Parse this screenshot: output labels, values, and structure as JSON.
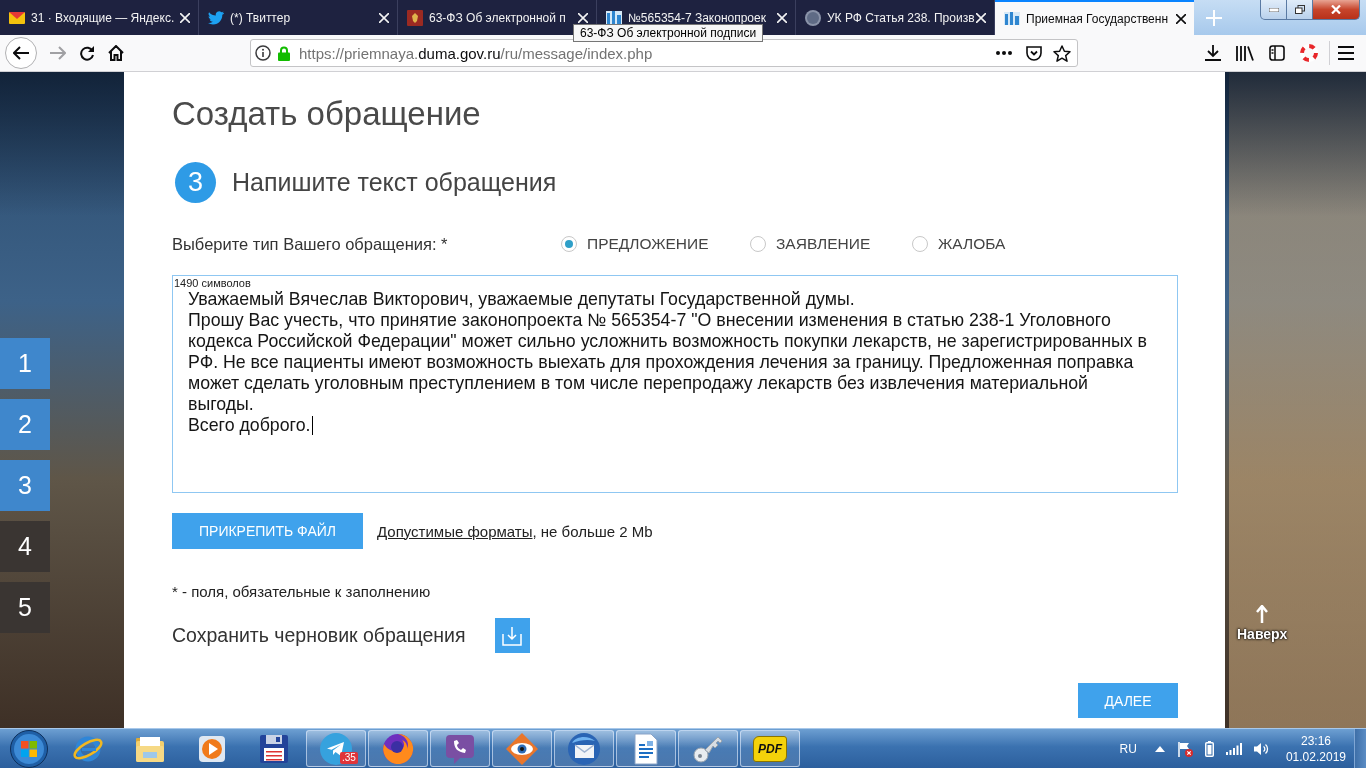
{
  "browser": {
    "tabs": [
      {
        "kind": "mail",
        "title": "31 · Входящие — Яндекс.",
        "selected": false
      },
      {
        "kind": "bird",
        "title": "(*) Твиттер",
        "selected": false
      },
      {
        "kind": "emblem",
        "title": "63-ФЗ Об электронной п",
        "selected": false
      },
      {
        "kind": "bars",
        "title": "№565354-7 Законопроек",
        "selected": false
      },
      {
        "kind": "avatar",
        "title": "УК РФ Статья 238. Произв",
        "selected": false
      },
      {
        "kind": "bars",
        "title": "Приемная Государственн",
        "selected": true
      }
    ],
    "tooltip": "63-ФЗ Об электронной подписи",
    "url": {
      "scheme": "https://priemnaya.",
      "domain": "duma.gov.ru",
      "path": "/ru/message/index.php"
    }
  },
  "steps": [
    {
      "label": "1",
      "reached": true
    },
    {
      "label": "2",
      "reached": true
    },
    {
      "label": "3",
      "reached": true
    },
    {
      "label": "4",
      "reached": false
    },
    {
      "label": "5",
      "reached": false
    }
  ],
  "page": {
    "title": "Создать обращение",
    "step": {
      "number": "3",
      "title": "Напишите текст обращения"
    },
    "type_label": "Выберите тип Вашего обращения: *",
    "types": [
      {
        "label": "ПРЕДЛОЖЕНИЕ",
        "selected": true
      },
      {
        "label": "ЗАЯВЛЕНИЕ",
        "selected": false
      },
      {
        "label": "ЖАЛОБА",
        "selected": false
      }
    ],
    "message": {
      "counter": "1490 символов",
      "focused": true,
      "paragraphs": [
        "Уважаемый Вячеслав Викторович, уважаемые депутаты Государственной думы.",
        "Прошу Вас учесть, что принятие законопроекта № 565354-7 \"О внесении изменения в статью 238-1 Уголовного кодекса Российской Федерации\" может сильно усложнить возможность покупки лекарств, не зарегистрированных в РФ. Не все пациенты имеют возможность выехать для прохождения лечения за границу. Предложенная поправка может сделать уголовным преступлением в том числе перепродажу лекарств без извлечения материальной выгоды.",
        "Всего доброго."
      ]
    },
    "attach_button": "ПРИКРЕПИТЬ ФАЙЛ",
    "formats_link": "Допустимые форматы",
    "formats_note": ", не больше 2 Mb",
    "required_note": "* - поля, обязательные к заполнению",
    "draft_label": "Сохранить черновик обращения",
    "next_button": "ДАЛЕЕ"
  },
  "back_to_top": "Наверх",
  "taskbar": {
    "apps": [
      {
        "kind": "globe",
        "running": false
      },
      {
        "kind": "folder",
        "running": false
      },
      {
        "kind": "player",
        "running": false
      },
      {
        "kind": "floppy",
        "running": false
      },
      {
        "kind": "plane",
        "running": true,
        "badge": ".35"
      },
      {
        "kind": "flame",
        "running": true
      },
      {
        "kind": "phone",
        "running": true
      },
      {
        "kind": "eye",
        "running": true
      },
      {
        "kind": "envelope",
        "running": true
      },
      {
        "kind": "document",
        "running": true
      },
      {
        "kind": "key",
        "running": true
      },
      {
        "kind": "pdf",
        "running": true,
        "label": "PDF"
      }
    ],
    "language": "RU",
    "time": "23:16",
    "date": "01.02.2019"
  }
}
